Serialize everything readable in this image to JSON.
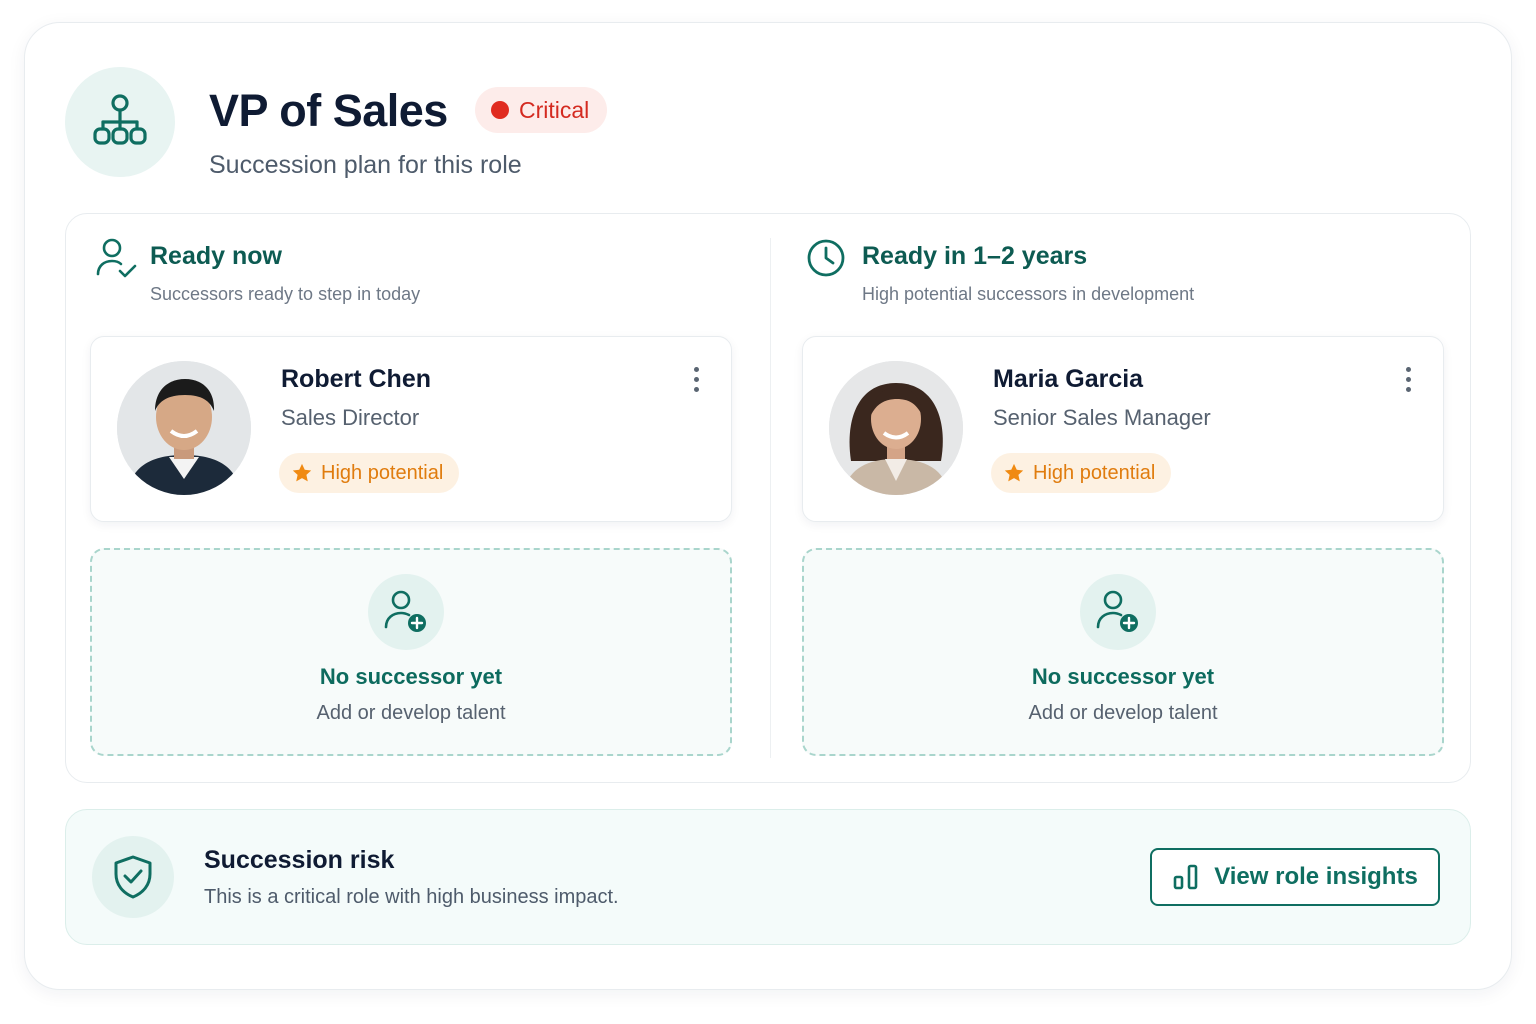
{
  "header": {
    "title": "VP of Sales",
    "badge": "Critical",
    "subtitle": "Succession plan for this role",
    "icon": "org-chart-icon"
  },
  "columns": [
    {
      "title": "Ready now",
      "subtitle": "Successors ready to step in today",
      "icon": "user-check-icon",
      "candidate": {
        "name": "Robert Chen",
        "role": "Sales Director",
        "tag": "High potential"
      },
      "empty": {
        "title": "No successor yet",
        "subtitle": "Add or develop talent"
      }
    },
    {
      "title": "Ready in 1–2 years",
      "subtitle": "High potential successors in development",
      "icon": "clock-icon",
      "candidate": {
        "name": "Maria Garcia",
        "role": "Senior Sales Manager",
        "tag": "High potential"
      },
      "empty": {
        "title": "No successor yet",
        "subtitle": "Add or develop talent"
      }
    }
  ],
  "risk": {
    "title": "Succession risk",
    "subtitle": "This is a critical role with high business impact.",
    "button": "View role insights",
    "icon": "shield-check-icon"
  },
  "colors": {
    "accent": "#0f6e61",
    "critical": "#e02b20",
    "high_potential": "#e07c0e"
  }
}
